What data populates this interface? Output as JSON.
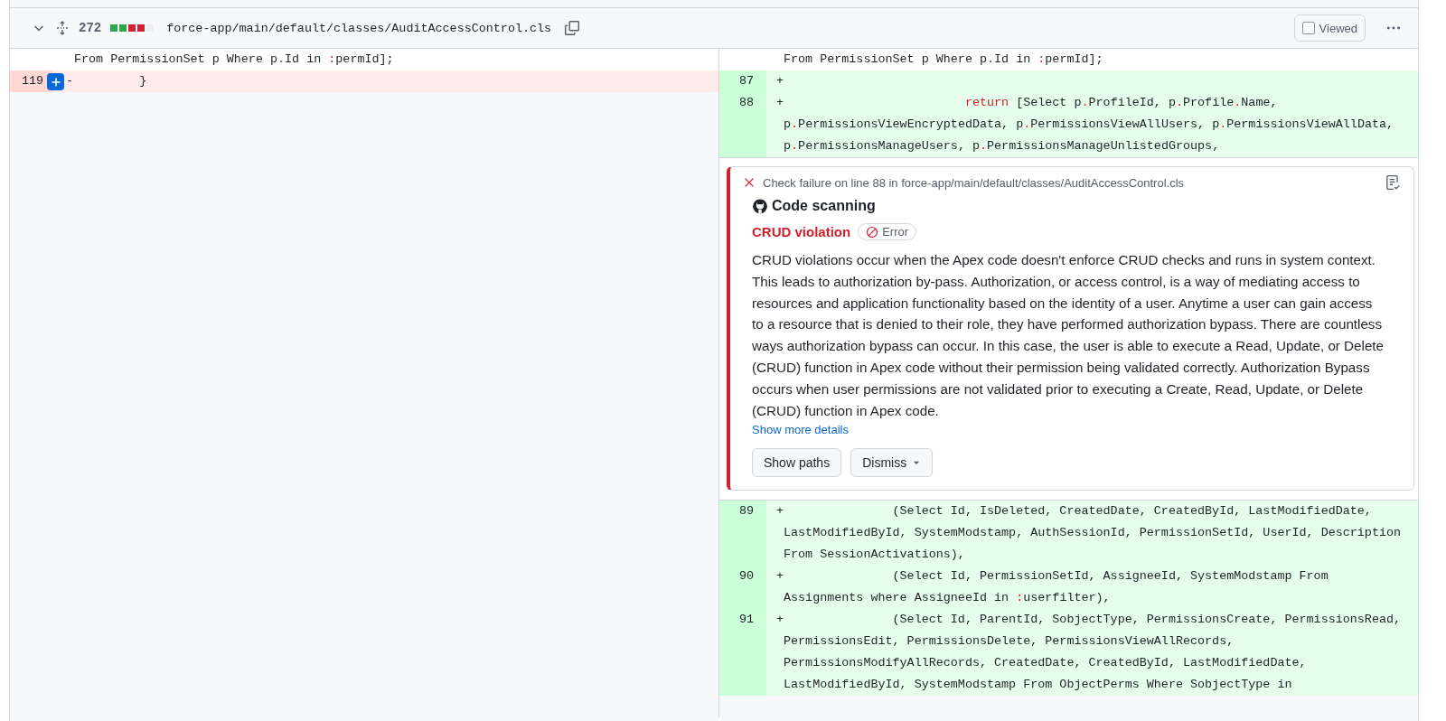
{
  "file_header": {
    "expanded": true,
    "changes": "272",
    "diffstat": [
      {
        "color": "#2da44e"
      },
      {
        "color": "#2da44e"
      },
      {
        "color": "#cf222e"
      },
      {
        "color": "#cf222e"
      },
      {
        "color": "#eaeef2"
      }
    ],
    "path": "force-app/main/default/classes/AuditAccessControl.cls",
    "viewed": {
      "label": "Viewed",
      "checked": false
    }
  },
  "left_rows": [
    {
      "kind": "context",
      "code": [
        {
          "text": "From PermissionSet p Where p",
          "kind": "plain"
        },
        {
          "text": ".",
          "kind": "punctuation"
        },
        {
          "text": "Id in ",
          "kind": "plain"
        },
        {
          "text": ":",
          "kind": "punctuation"
        },
        {
          "text": "permId];",
          "kind": "plain"
        }
      ]
    },
    {
      "kind": "deletion",
      "number": "119",
      "marker": "-",
      "comment_button": true,
      "code": [
        {
          "text": "         }",
          "kind": "plain"
        }
      ]
    }
  ],
  "right_rows": [
    {
      "kind": "context",
      "code": [
        {
          "text": "From PermissionSet p Where p",
          "kind": "plain"
        },
        {
          "text": ".",
          "kind": "punctuation"
        },
        {
          "text": "Id in ",
          "kind": "plain"
        },
        {
          "text": ":",
          "kind": "punctuation"
        },
        {
          "text": "permId];",
          "kind": "plain"
        }
      ]
    },
    {
      "kind": "addition",
      "number": "87",
      "marker": "+"
    },
    {
      "kind": "addition",
      "number": "88",
      "marker": "+",
      "code": [
        {
          "text": "                         return",
          "kind": "keyword"
        },
        {
          "text": " [Select p",
          "kind": "plain"
        },
        {
          "text": ".",
          "kind": "punctuation"
        },
        {
          "text": "ProfileId, p",
          "kind": "plain"
        },
        {
          "text": ".",
          "kind": "punctuation"
        },
        {
          "text": "Profile",
          "kind": "plain"
        },
        {
          "text": ".",
          "kind": "punctuation"
        },
        {
          "text": "Name, p",
          "kind": "plain"
        },
        {
          "text": ".",
          "kind": "punctuation"
        },
        {
          "text": "PermissionsViewEncryptedData, p",
          "kind": "plain"
        },
        {
          "text": ".",
          "kind": "punctuation"
        },
        {
          "text": "PermissionsViewAllUsers, p",
          "kind": "plain"
        },
        {
          "text": ".",
          "kind": "punctuation"
        },
        {
          "text": "PermissionsViewAllData, p",
          "kind": "plain"
        },
        {
          "text": ".",
          "kind": "punctuation"
        },
        {
          "text": "PermissionsManageUsers, p",
          "kind": "plain"
        },
        {
          "text": ".",
          "kind": "punctuation"
        },
        {
          "text": "PermissionsManageUnlistedGroups,",
          "kind": "plain"
        }
      ]
    },
    {
      "kind": "annotation",
      "title": "Check failure on line 88 in force-app/main/default/classes/AuditAccessControl.cls",
      "tool": "Code scanning",
      "rule": "CRUD violation",
      "severity": "Error",
      "description": "CRUD violations occur when the Apex code doesn't enforce CRUD checks and runs in system context. This leads to authorization by-pass. Authorization, or access control, is a way of mediating access to resources and application functionality based on the identity of a user. Anytime a user can gain access to a resource that is denied to their role, they have performed authorization bypass. There are countless ways authorization bypass can occur. In this case, the user is able to execute a Read, Update, or Delete (CRUD) function in Apex code without their permission being validated correctly. Authorization Bypass occurs when user permissions are not validated prior to executing a Create, Read, Update, or Delete (CRUD) function in Apex code.",
      "link": "Show more details",
      "buttons": [
        {
          "label": "Show paths",
          "kind": "plain"
        },
        {
          "label": "Dismiss",
          "kind": "dropdown"
        }
      ]
    },
    {
      "kind": "addition",
      "number": "89",
      "marker": "+",
      "code": [
        {
          "text": "               (Select Id, IsDeleted, CreatedDate, CreatedById, LastModifiedDate, LastModifiedById, SystemModstamp, AuthSessionId, PermissionSetId, UserId, Description From SessionActivations),",
          "kind": "plain"
        }
      ]
    },
    {
      "kind": "addition",
      "number": "90",
      "marker": "+",
      "code": [
        {
          "text": "               (Select Id, PermissionSetId, AssigneeId, SystemModstamp From Assignments where AssigneeId in ",
          "kind": "plain"
        },
        {
          "text": ":",
          "kind": "punctuation"
        },
        {
          "text": "userfilter),",
          "kind": "plain"
        }
      ]
    },
    {
      "kind": "addition",
      "number": "91",
      "marker": "+",
      "code": [
        {
          "text": "               (Select Id, ParentId, SobjectType, PermissionsCreate, PermissionsRead, PermissionsEdit, PermissionsDelete, PermissionsViewAllRecords, PermissionsModifyAllRecords, CreatedDate, CreatedById, LastModifiedDate, LastModifiedById, SystemModstamp From ObjectPerms Where SobjectType in",
          "kind": "plain"
        }
      ]
    }
  ]
}
